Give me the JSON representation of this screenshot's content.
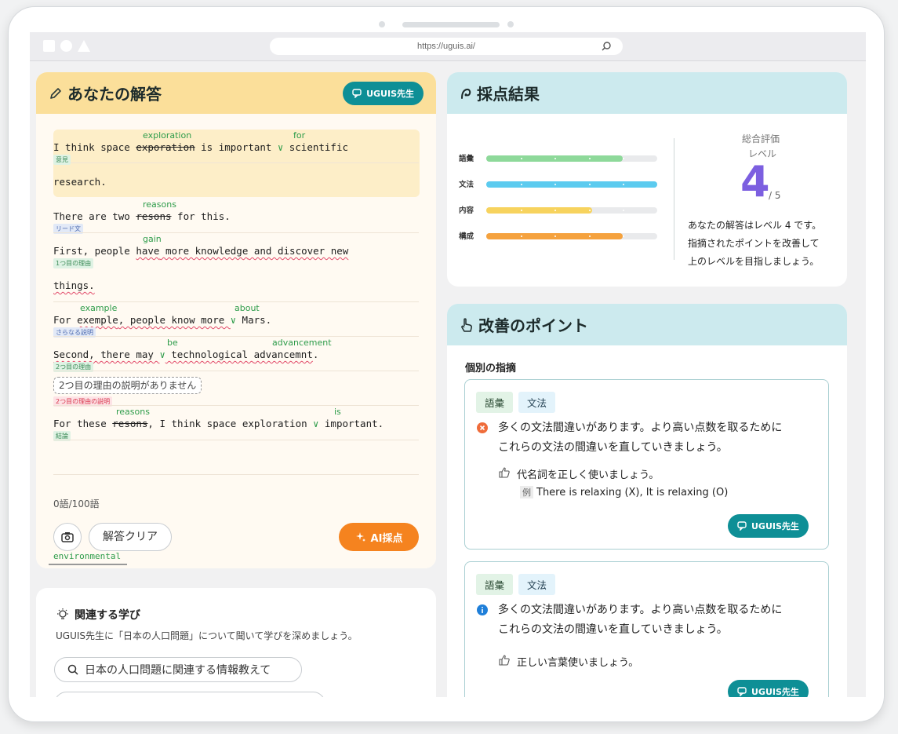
{
  "browser": {
    "url": "https://uguis.ai/"
  },
  "answer_card": {
    "title": "あなたの解答",
    "teacher_button": "UGUIS先生",
    "lines": {
      "l1": {
        "pre": "I think space ",
        "struck": "exporation",
        "mid": " is important ",
        "post": " scientific",
        "corr1": "exploration",
        "corr2": "for",
        "tag": "意見"
      },
      "l2": {
        "text": "research."
      },
      "l3": {
        "pre": "There are two ",
        "struck": "resons",
        "post": " for this.",
        "corr": "reasons",
        "tag": "リード文"
      },
      "l4": {
        "pre": "First, people ",
        "struck": "have",
        "mid": " more knowledge",
        "post": " and discover new",
        "corr": "gain",
        "tag": "1つ目の理由"
      },
      "l5": {
        "text": "things."
      },
      "l6": {
        "pre": "For ",
        "struck": "exemple",
        "mid": ", people know more ",
        "post": " Mars.",
        "corr1": "example",
        "corr2": "about",
        "tag": "さらなる説明"
      },
      "l7": {
        "pre": "Second, there may ",
        "mid": " technological ",
        "struck": "advancemnt",
        "post": ".",
        "corr1": "be",
        "corr2": "advancement",
        "tag": "2つ目の理由"
      },
      "l8": {
        "missing": "2つ目の理由の説明がありません",
        "tag": "2つ目の理由の説明"
      },
      "l9": {
        "pre": "For these ",
        "struck": "resons",
        "mid": ", I think space exploration ",
        "post": " important.",
        "corr1": "reasons",
        "corr2": "is",
        "tag": "結論"
      }
    },
    "word_count": "0語/100語",
    "clear_button": "解答クリア",
    "ai_button": "AI採点",
    "suggestion": "environmental"
  },
  "related": {
    "title": "関連する学び",
    "desc": "UGUIS先生に「日本の人口問題」について聞いて学びを深めましょう。",
    "query1": "日本の人口問題に関連する情報教えて"
  },
  "score_card": {
    "title": "採点結果",
    "overall_label1": "総合評価",
    "overall_label2": "レベル",
    "level": "4",
    "level_max": "/ 5",
    "summary1": "あなたの解答はレベル 4 です。",
    "summary2": "指摘されたポイントを改善して",
    "summary3": "上のレベルを目指しましょう。",
    "bars": [
      {
        "label": "語彙",
        "level": 0.8,
        "color": "#8ed99a"
      },
      {
        "label": "文法",
        "level": 1.0,
        "color": "#5ccbef"
      },
      {
        "label": "内容",
        "level": 0.62,
        "color": "#f7d35e"
      },
      {
        "label": "構成",
        "level": 0.8,
        "color": "#f5a23e"
      }
    ]
  },
  "improve_card": {
    "title": "改善のポイント",
    "section": "個別の指摘",
    "point1": {
      "chip1": "語彙",
      "chip2": "文法",
      "msg1": "多くの文法間違いがあります。より高い点数を取るために",
      "msg2": "これらの文法の間違いを直していきましょう。",
      "advice": "代名詞を正しく使いましょう。",
      "example_badge": "例",
      "example": "There is relaxing (X), It is relaxing (O)",
      "button": "UGUIS先生"
    },
    "point2": {
      "chip1": "語彙",
      "chip2": "文法",
      "msg1": "多くの文法間違いがあります。より高い点数を取るために",
      "msg2": "これらの文法の間違いを直していきましょう。",
      "advice": "正しい言葉使いましょう。",
      "button": "UGUIS先生"
    }
  }
}
